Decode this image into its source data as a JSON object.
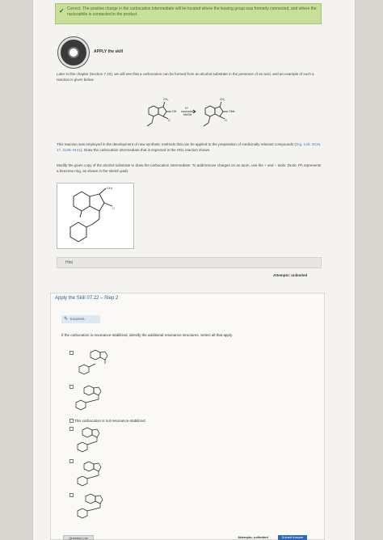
{
  "banner": {
    "text": "Correct. The positive charge in the carbocation intermediate will be located where the leaving group was formerly connected, and where the nucleophile is connected in the product."
  },
  "apply": {
    "label": "APPLY the skill"
  },
  "intro": {
    "text": "Later in this chapter (Section 7.10), we will see that a carbocation can be formed from an alcohol substrate in the presence of an acid, and an example of such a reaction is given below."
  },
  "reaction": {
    "reagent": "H⁺",
    "nucleophile": "MeOH",
    "sub_oh": "OH",
    "sub_ome": "OMe",
    "sub_ch3": "CH₃"
  },
  "context": {
    "text_before_link": "This reaction was employed in the development of new synthetic methods that can be applied to the preparation of medicinally relevant compounds (",
    "link": "Org. Lett. 2015, 17, 3138–3141",
    "text_after_link": "). Draw the carbocation intermediate that is expected in the SN1 reaction shown."
  },
  "instructions": {
    "text": "Modify the given copy of the alcohol substrate to draw the carbocation intermediate. To add/remove charges on an atom, use the + and − tools. (Note: Ph represents a benzene ring, as shown in the sketch pad)"
  },
  "sketch": {
    "ch3": "CH₃",
    "o": "O"
  },
  "hint": {
    "label": "Hint"
  },
  "attempts_top": {
    "label": "Attempts: unlimited"
  },
  "step": {
    "title": "Apply the Skill 07.22 – Step 2",
    "status": "Incorrect.",
    "question": "If the carbocation is resonance-stabilized, identify the additional resonance structures. Select all that apply.",
    "options": [
      {
        "label": ""
      },
      {
        "label": ""
      },
      {
        "label": "This carbocation is not resonance-stabilized."
      },
      {
        "label": ""
      },
      {
        "label": ""
      },
      {
        "label": ""
      }
    ]
  },
  "bottom": {
    "left_button": "Question List",
    "attempts": "Attempts: unlimited",
    "submit": "Submit Answer"
  }
}
